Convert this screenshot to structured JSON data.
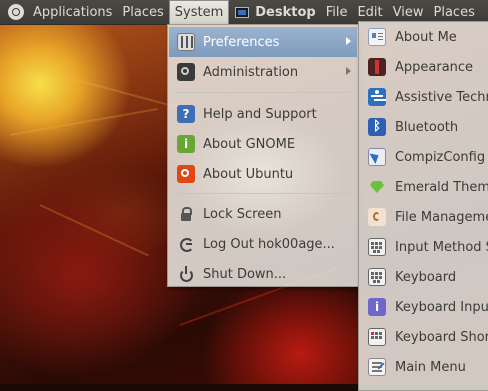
{
  "top_panel": {
    "menus": [
      "Applications",
      "Places",
      "System"
    ],
    "active_menu": "System",
    "window_title": "Desktop",
    "window_menus": [
      "File",
      "Edit",
      "View",
      "Places"
    ]
  },
  "system_menu": {
    "items": [
      {
        "label": "Preferences",
        "icon": "preferences-icon",
        "submenu": true,
        "highlighted": true
      },
      {
        "label": "Administration",
        "icon": "administration-icon",
        "submenu": true
      },
      {
        "label": "Help and Support",
        "icon": "help-icon",
        "icon_text": "?"
      },
      {
        "label": "About GNOME",
        "icon": "gnome-info-icon",
        "icon_text": "i"
      },
      {
        "label": "About Ubuntu",
        "icon": "ubuntu-logo-icon"
      },
      {
        "label": "Lock Screen",
        "icon": "lock-icon"
      },
      {
        "label": "Log Out hok00age...",
        "icon": "logout-icon"
      },
      {
        "label": "Shut Down...",
        "icon": "power-icon"
      }
    ]
  },
  "preferences_menu": {
    "items": [
      {
        "label": "About Me",
        "icon": "about-me-icon"
      },
      {
        "label": "Appearance",
        "icon": "appearance-icon"
      },
      {
        "label": "Assistive Technologies",
        "icon": "accessibility-icon"
      },
      {
        "label": "Bluetooth",
        "icon": "bluetooth-icon",
        "icon_text": "ᛒ"
      },
      {
        "label": "CompizConfig Settings Manager",
        "icon": "compiz-icon"
      },
      {
        "label": "Emerald Theme Manager",
        "icon": "emerald-icon"
      },
      {
        "label": "File Management",
        "icon": "file-management-icon"
      },
      {
        "label": "Input Method Switcher",
        "icon": "keyboard-icon"
      },
      {
        "label": "Keyboard",
        "icon": "keyboard-icon"
      },
      {
        "label": "Keyboard Input Methods",
        "icon": "keyboard-input-icon",
        "icon_text": "i"
      },
      {
        "label": "Keyboard Shortcuts",
        "icon": "keyboard-shortcuts-icon"
      },
      {
        "label": "Main Menu",
        "icon": "main-menu-icon"
      }
    ]
  },
  "colors": {
    "panel_bg": "#3c3b37",
    "menu_bg": "#eae8e2",
    "highlight": "#8aa5c4"
  }
}
